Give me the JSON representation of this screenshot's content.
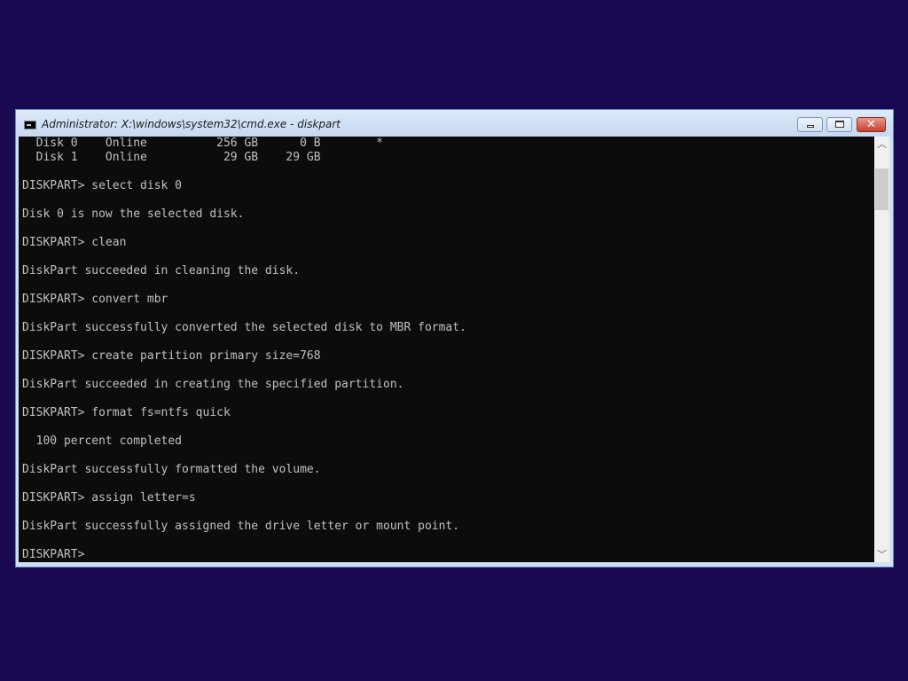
{
  "window": {
    "title": "Administrator: X:\\windows\\system32\\cmd.exe - diskpart",
    "minimize_label": "",
    "maximize_label": "",
    "close_label": "✕"
  },
  "console": {
    "lines": [
      "  Disk 0    Online          256 GB      0 B        *",
      "  Disk 1    Online           29 GB    29 GB",
      "",
      "DISKPART> select disk 0",
      "",
      "Disk 0 is now the selected disk.",
      "",
      "DISKPART> clean",
      "",
      "DiskPart succeeded in cleaning the disk.",
      "",
      "DISKPART> convert mbr",
      "",
      "DiskPart successfully converted the selected disk to MBR format.",
      "",
      "DISKPART> create partition primary size=768",
      "",
      "DiskPart succeeded in creating the specified partition.",
      "",
      "DISKPART> format fs=ntfs quick",
      "",
      "  100 percent completed",
      "",
      "DiskPart successfully formatted the volume.",
      "",
      "DISKPART> assign letter=s",
      "",
      "DiskPart successfully assigned the drive letter or mount point.",
      "",
      "DISKPART> "
    ]
  },
  "scrollbar": {
    "up_arrow": "︿",
    "down_arrow": "﹀"
  },
  "colors": {
    "desktop": "#1a0850",
    "console_bg": "#0c0c0c",
    "console_fg": "#c0c0c0"
  }
}
